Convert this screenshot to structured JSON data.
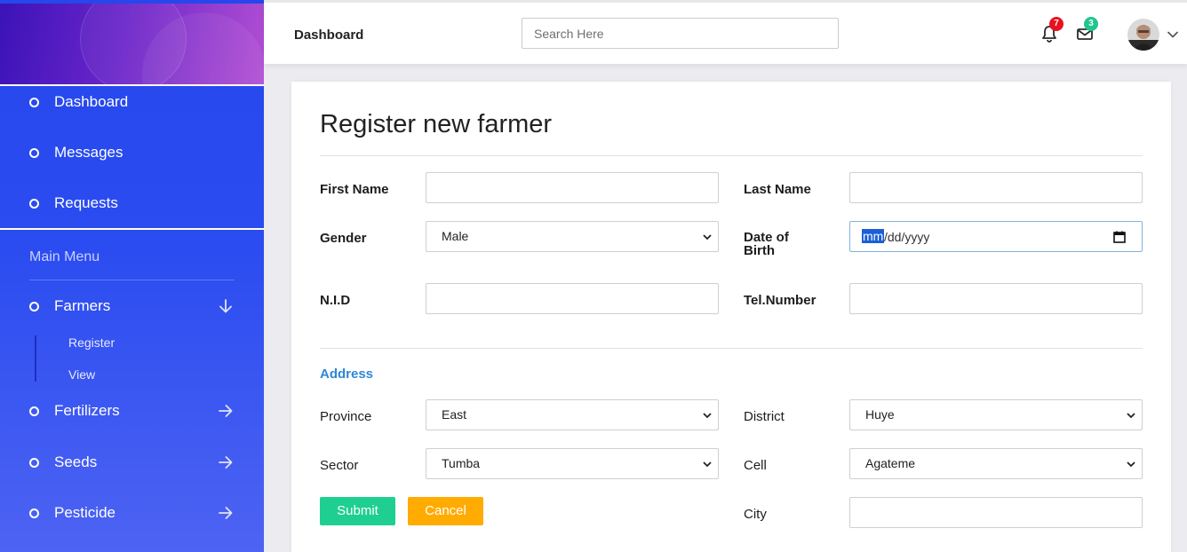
{
  "sidebar": {
    "top_items": [
      {
        "label": "Dashboard"
      },
      {
        "label": "Messages"
      },
      {
        "label": "Requests"
      }
    ],
    "menu_title": "Main Menu",
    "menu_items": [
      {
        "label": "Farmers",
        "arrow": "arrow-down-icon"
      },
      {
        "label": "Fertilizers",
        "arrow": "arrow-right-icon"
      },
      {
        "label": "Seeds",
        "arrow": "arrow-right-icon"
      },
      {
        "label": "Pesticide",
        "arrow": "arrow-right-icon"
      }
    ],
    "farmers_sub": [
      "Register",
      "View"
    ]
  },
  "topbar": {
    "title": "Dashboard",
    "search_placeholder": "Search Here",
    "notifications_count": "7",
    "messages_count": "3",
    "notification_badge_color": "#e8111d",
    "message_badge_color": "#1fc58f"
  },
  "form": {
    "title": "Register new farmer",
    "first_name_label": "First Name",
    "last_name_label": "Last Name",
    "gender_label": "Gender",
    "gender_value": "Male",
    "dob_label_1": "Date of",
    "dob_label_2": "Birth",
    "dob_mm": "mm",
    "dob_rest": "/dd/yyyy",
    "nid_label": "N.I.D",
    "tel_label": "Tel.Number",
    "address_heading": "Address",
    "province_label": "Province",
    "province_value": "East",
    "district_label": "District",
    "district_value": "Huye",
    "sector_label": "Sector",
    "sector_value": "Tumba",
    "cell_label": "Cell",
    "cell_value": "Agateme",
    "city_label": "City",
    "submit_label": "Submit",
    "cancel_label": "Cancel",
    "submit_color": "#1ecf91",
    "cancel_color": "#ffab00"
  }
}
